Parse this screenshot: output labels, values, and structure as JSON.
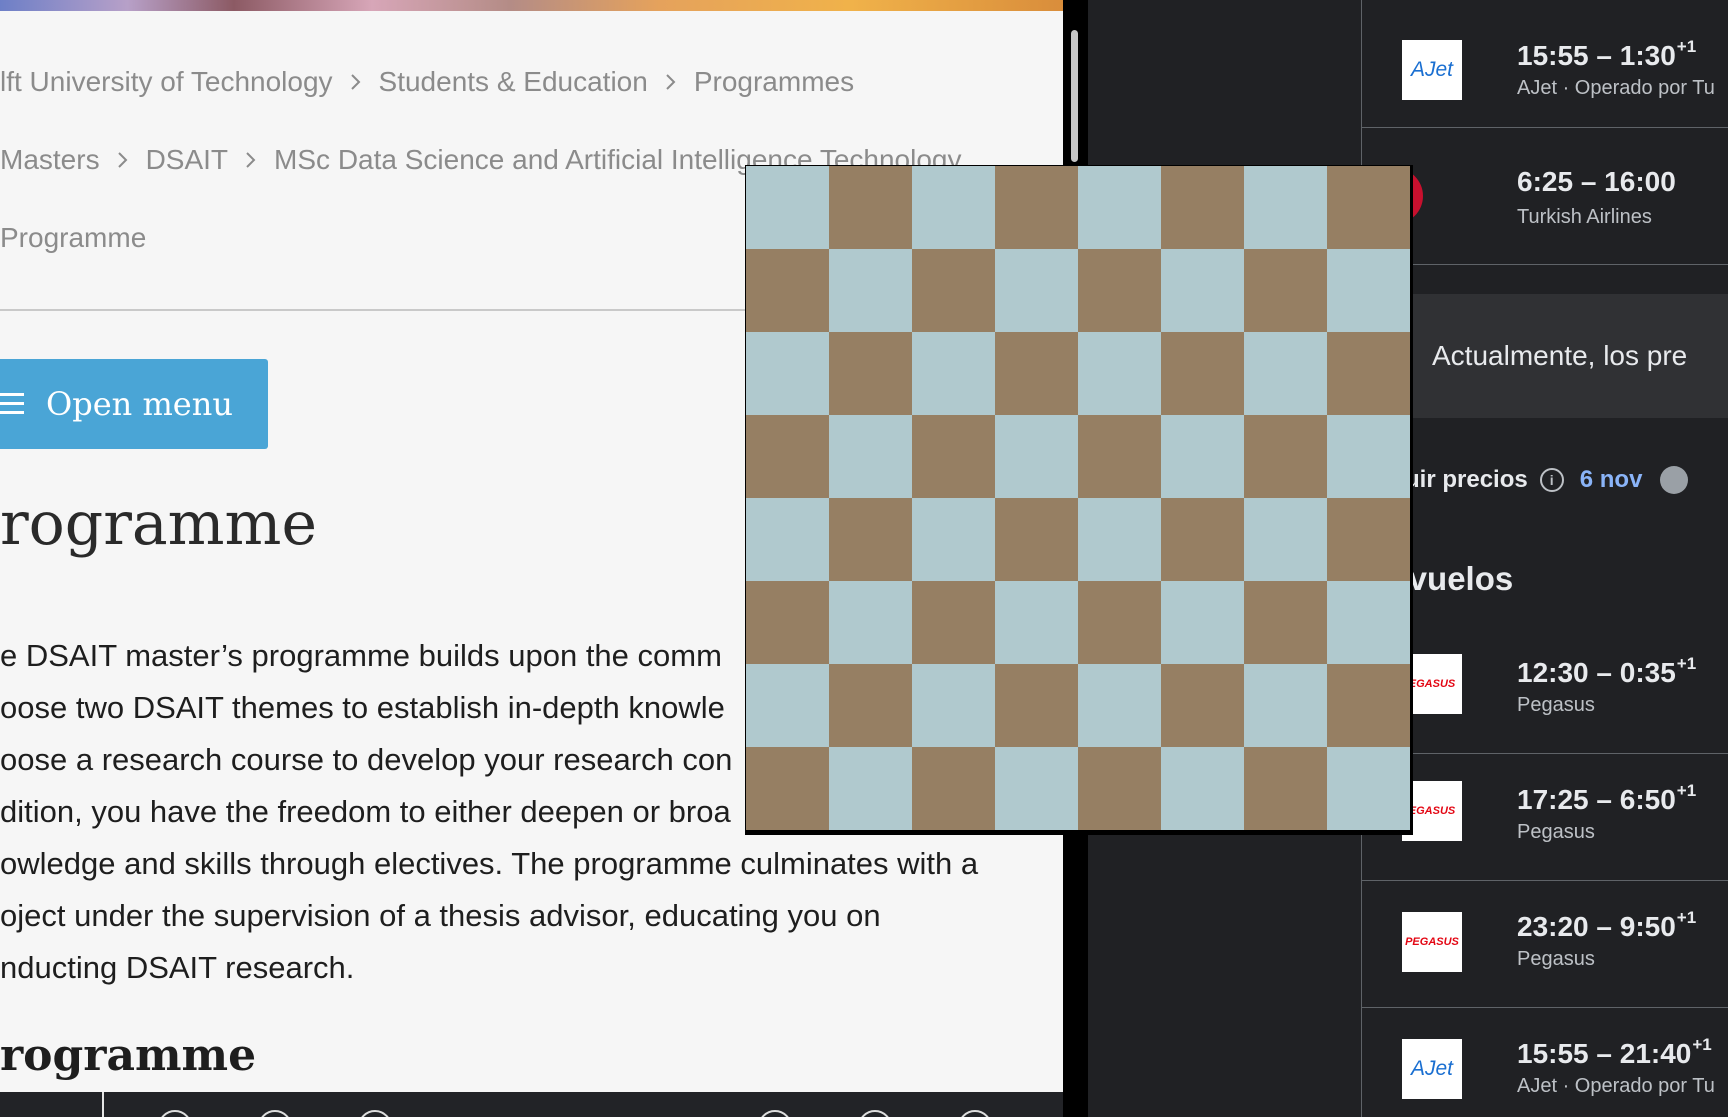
{
  "left_page": {
    "breadcrumbs": {
      "row1": [
        "lft University of Technology",
        "Students & Education",
        "Programmes"
      ],
      "row2": [
        "Masters",
        "DSAIT",
        "MSc Data Science and Artificial Intelligence Technology"
      ],
      "row3": [
        "Programme"
      ]
    },
    "open_menu_label": "Open menu",
    "heading": "rogramme",
    "intro_lines": [
      "e DSAIT master’s programme builds upon the comm",
      "oose two DSAIT themes to establish in-depth knowle",
      "oose a research course to develop your research con",
      "dition, you have the freedom to either deepen or broa",
      "owledge and skills through electives. The programme culminates with a",
      "oject under the supervision of a thesis advisor, educating you on",
      "nducting DSAIT research."
    ],
    "section_heading": "rogramme"
  },
  "flights_panel": {
    "flights_top": [
      {
        "times": "15:55 – 1:30",
        "day_offset": "+1",
        "carrier": "AJet · Operado por Tu",
        "logo": "ajet-logo",
        "logo_text": "AJet"
      },
      {
        "times": "6:25 – 16:00",
        "day_offset": "",
        "carrier": "Turkish Airlines",
        "logo": "turkish-airlines-logo",
        "logo_text": ""
      }
    ],
    "price_notice": "Actualmente, los pre",
    "track_prices_label": "Seguir precios",
    "track_date": "6 nov",
    "other_flights_heading": "os vuelos",
    "flights_other": [
      {
        "times": "12:30 – 0:35",
        "day_offset": "+1",
        "carrier": "Pegasus",
        "logo": "pegasus-logo",
        "logo_text": "EGASUS"
      },
      {
        "times": "17:25 – 6:50",
        "day_offset": "+1",
        "carrier": "Pegasus",
        "logo": "pegasus-logo",
        "logo_text": "EGASUS"
      },
      {
        "times": "23:20 – 9:50",
        "day_offset": "+1",
        "carrier": "Pegasus",
        "logo": "pegasus-logo",
        "logo_text": "PEGASUS"
      },
      {
        "times": "15:55 – 21:40",
        "day_offset": "+1",
        "carrier": "AJet · Operado por Tu",
        "logo": "ajet-logo",
        "logo_text": "AJet"
      }
    ]
  },
  "checkerboard": {
    "rows": 8,
    "cols": 8,
    "color_light": "#b0c9ce",
    "color_dark": "#967f63"
  },
  "colors": {
    "accent_blue": "#4aa5d6",
    "link_blue": "#8ab4f8",
    "dark_panel": "#202124"
  }
}
